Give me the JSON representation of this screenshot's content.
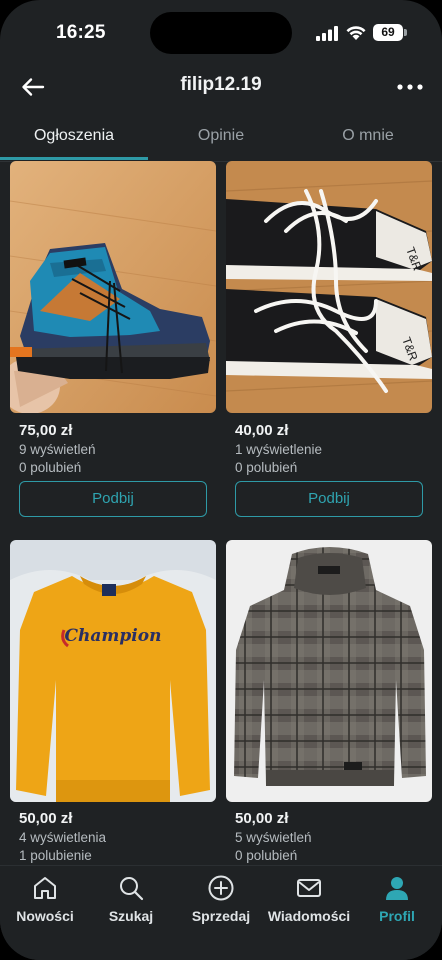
{
  "status_bar": {
    "time": "16:25",
    "battery": "69"
  },
  "header": {
    "title": "filip12.19"
  },
  "tabs": [
    {
      "label": "Ogłoszenia",
      "active": true
    },
    {
      "label": "Opinie",
      "active": false
    },
    {
      "label": "O mnie",
      "active": false
    }
  ],
  "listings": [
    {
      "price": "75,00 zł",
      "views": "9 wyświetleń",
      "likes": "0 polubień",
      "bump_label": "Podbij",
      "image": "hiking-boot-photo"
    },
    {
      "price": "40,00 zł",
      "views": "1 wyświetlenie",
      "likes": "0 polubień",
      "bump_label": "Podbij",
      "image": "canvas-sneakers-photo"
    },
    {
      "price": "50,00 zł",
      "views": "4 wyświetlenia",
      "likes": "1 polubienie",
      "image": "yellow-sweatshirt-photo",
      "brand_text": "Champion"
    },
    {
      "price": "50,00 zł",
      "views": "5 wyświetleń",
      "likes": "0 polubień",
      "image": "plaid-hoodie-photo"
    }
  ],
  "bottom_nav": [
    {
      "label": "Nowości",
      "icon": "home-icon",
      "active": false
    },
    {
      "label": "Szukaj",
      "icon": "search-icon",
      "active": false
    },
    {
      "label": "Sprzedaj",
      "icon": "plus-circle-icon",
      "active": false
    },
    {
      "label": "Wiadomości",
      "icon": "mail-icon",
      "active": false
    },
    {
      "label": "Profil",
      "icon": "profile-icon",
      "active": true
    }
  ],
  "colors": {
    "accent": "#2e9aa6",
    "background": "#1f2224"
  }
}
